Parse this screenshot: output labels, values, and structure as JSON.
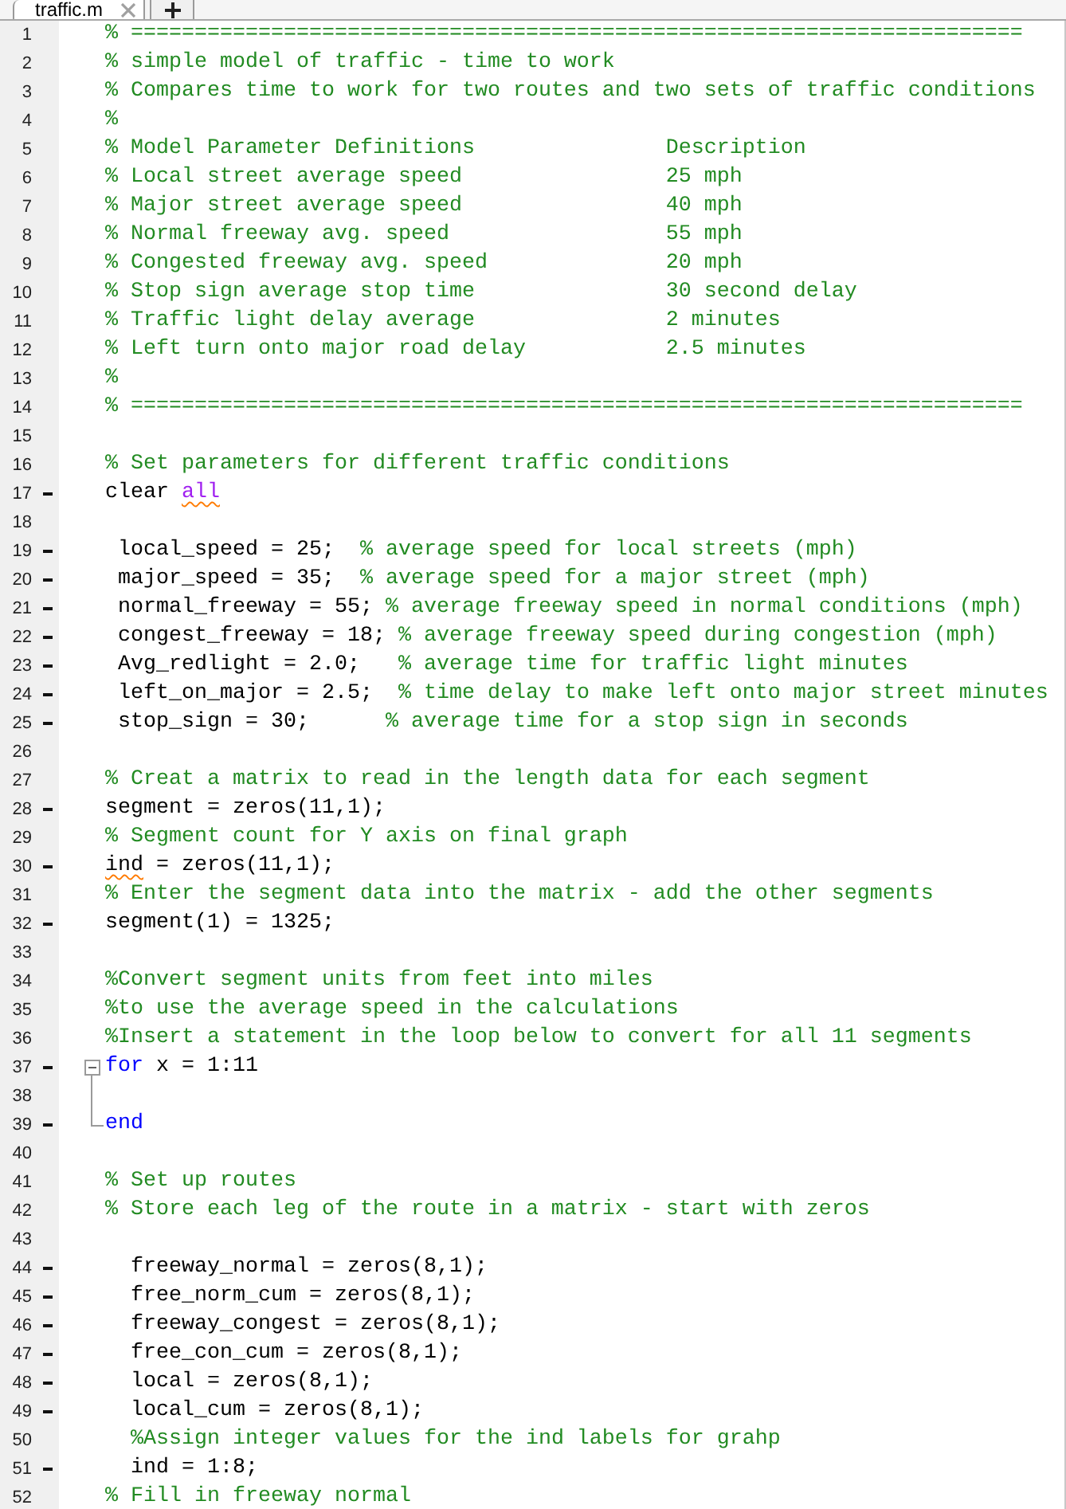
{
  "tabs": [
    {
      "label": "traffic.m",
      "selected": true
    }
  ],
  "lines": [
    {
      "number": "1",
      "executable": false,
      "segments": [
        {
          "kind": "comment",
          "text": "% ======================================================================",
          "warning": false
        }
      ]
    },
    {
      "number": "2",
      "executable": false,
      "segments": [
        {
          "kind": "comment",
          "text": "% simple model of traffic - time to work",
          "warning": false
        }
      ]
    },
    {
      "number": "3",
      "executable": false,
      "segments": [
        {
          "kind": "comment",
          "text": "% Compares time to work for two routes and two sets of traffic conditions",
          "warning": false
        }
      ]
    },
    {
      "number": "4",
      "executable": false,
      "segments": [
        {
          "kind": "comment",
          "text": "%",
          "warning": false
        }
      ]
    },
    {
      "number": "5",
      "executable": false,
      "segments": [
        {
          "kind": "comment",
          "text": "% Model Parameter Definitions               Description",
          "warning": false
        }
      ]
    },
    {
      "number": "6",
      "executable": false,
      "segments": [
        {
          "kind": "comment",
          "text": "% Local street average speed                25 mph",
          "warning": false
        }
      ]
    },
    {
      "number": "7",
      "executable": false,
      "segments": [
        {
          "kind": "comment",
          "text": "% Major street average speed                40 mph",
          "warning": false
        }
      ]
    },
    {
      "number": "8",
      "executable": false,
      "segments": [
        {
          "kind": "comment",
          "text": "% Normal freeway avg. speed                 55 mph",
          "warning": false
        }
      ]
    },
    {
      "number": "9",
      "executable": false,
      "segments": [
        {
          "kind": "comment",
          "text": "% Congested freeway avg. speed              20 mph",
          "warning": false
        }
      ]
    },
    {
      "number": "10",
      "executable": false,
      "segments": [
        {
          "kind": "comment",
          "text": "% Stop sign average stop time               30 second delay",
          "warning": false
        }
      ]
    },
    {
      "number": "11",
      "executable": false,
      "segments": [
        {
          "kind": "comment",
          "text": "% Traffic light delay average               2 minutes",
          "warning": false
        }
      ]
    },
    {
      "number": "12",
      "executable": false,
      "segments": [
        {
          "kind": "comment",
          "text": "% Left turn onto major road delay           2.5 minutes",
          "warning": false
        }
      ]
    },
    {
      "number": "13",
      "executable": false,
      "segments": [
        {
          "kind": "comment",
          "text": "%",
          "warning": false
        }
      ]
    },
    {
      "number": "14",
      "executable": false,
      "segments": [
        {
          "kind": "comment",
          "text": "% ======================================================================",
          "warning": false
        }
      ]
    },
    {
      "number": "15",
      "executable": false
    },
    {
      "number": "16",
      "executable": false,
      "segments": [
        {
          "kind": "comment",
          "text": "% Set parameters for different traffic conditions",
          "warning": false
        }
      ]
    },
    {
      "number": "17",
      "executable": true,
      "segments": [
        {
          "kind": "code",
          "text": "clear ",
          "warning": false
        },
        {
          "kind": "string",
          "text": "all",
          "warning": true
        }
      ]
    },
    {
      "number": "18",
      "executable": false
    },
    {
      "number": "19",
      "executable": true,
      "segments": [
        {
          "kind": "code",
          "text": " local_speed = 25;  ",
          "warning": false
        },
        {
          "kind": "comment",
          "text": "% average speed for local streets (mph)",
          "warning": false
        }
      ]
    },
    {
      "number": "20",
      "executable": true,
      "segments": [
        {
          "kind": "code",
          "text": " major_speed = 35;  ",
          "warning": false
        },
        {
          "kind": "comment",
          "text": "% average speed for a major street (mph)",
          "warning": false
        }
      ]
    },
    {
      "number": "21",
      "executable": true,
      "segments": [
        {
          "kind": "code",
          "text": " normal_freeway = 55; ",
          "warning": false
        },
        {
          "kind": "comment",
          "text": "% average freeway speed in normal conditions (mph)",
          "warning": false
        }
      ]
    },
    {
      "number": "22",
      "executable": true,
      "segments": [
        {
          "kind": "code",
          "text": " congest_freeway = 18; ",
          "warning": false
        },
        {
          "kind": "comment",
          "text": "% average freeway speed during congestion (mph)",
          "warning": false
        }
      ]
    },
    {
      "number": "23",
      "executable": true,
      "segments": [
        {
          "kind": "code",
          "text": " Avg_redlight = 2.0;   ",
          "warning": false
        },
        {
          "kind": "comment",
          "text": "% average time for traffic light minutes",
          "warning": false
        }
      ]
    },
    {
      "number": "24",
      "executable": true,
      "segments": [
        {
          "kind": "code",
          "text": " left_on_major = 2.5;  ",
          "warning": false
        },
        {
          "kind": "comment",
          "text": "% time delay to make left onto major street minutes",
          "warning": false
        }
      ]
    },
    {
      "number": "25",
      "executable": true,
      "segments": [
        {
          "kind": "code",
          "text": " stop_sign = 30;      ",
          "warning": false
        },
        {
          "kind": "comment",
          "text": "% average time for a stop sign in seconds",
          "warning": false
        }
      ]
    },
    {
      "number": "26",
      "executable": false
    },
    {
      "number": "27",
      "executable": false,
      "segments": [
        {
          "kind": "comment",
          "text": "% Creat a matrix to read in the length data for each segment",
          "warning": false
        }
      ]
    },
    {
      "number": "28",
      "executable": true,
      "segments": [
        {
          "kind": "code",
          "text": "segment = zeros(11,1);",
          "warning": false
        }
      ]
    },
    {
      "number": "29",
      "executable": false,
      "segments": [
        {
          "kind": "comment",
          "text": "% Segment count for Y axis on final graph",
          "warning": false
        }
      ]
    },
    {
      "number": "30",
      "executable": true,
      "segments": [
        {
          "kind": "code",
          "text": "ind",
          "warning": true
        },
        {
          "kind": "code",
          "text": " = zeros(11,1);",
          "warning": false
        }
      ]
    },
    {
      "number": "31",
      "executable": false,
      "segments": [
        {
          "kind": "comment",
          "text": "% Enter the segment data into the matrix - add the other segments",
          "warning": false
        }
      ]
    },
    {
      "number": "32",
      "executable": true,
      "segments": [
        {
          "kind": "code",
          "text": "segment(1) = 1325;",
          "warning": false
        }
      ]
    },
    {
      "number": "33",
      "executable": false
    },
    {
      "number": "34",
      "executable": false,
      "segments": [
        {
          "kind": "comment",
          "text": "%Convert segment units from feet into miles",
          "warning": false
        }
      ]
    },
    {
      "number": "35",
      "executable": false,
      "segments": [
        {
          "kind": "comment",
          "text": "%to use the average speed in the calculations",
          "warning": false
        }
      ]
    },
    {
      "number": "36",
      "executable": false,
      "segments": [
        {
          "kind": "comment",
          "text": "%Insert a statement in the loop below to convert for all 11 segments",
          "warning": false
        }
      ]
    },
    {
      "number": "37",
      "executable": true,
      "expanded": true,
      "segments": [
        {
          "kind": "keyword",
          "text": "for",
          "warning": false
        },
        {
          "kind": "code",
          "text": " x = 1:11",
          "warning": false
        }
      ],
      "children": [
        {
          "number": "38",
          "executable": false
        },
        {
          "number": "39",
          "executable": true,
          "segments": [
            {
              "kind": "keyword",
              "text": "end",
              "warning": false
            }
          ]
        }
      ]
    },
    {
      "number": "40",
      "executable": false
    },
    {
      "number": "41",
      "executable": false,
      "segments": [
        {
          "kind": "comment",
          "text": "% Set up routes",
          "warning": false
        }
      ]
    },
    {
      "number": "42",
      "executable": false,
      "segments": [
        {
          "kind": "comment",
          "text": "% Store each leg of the route in a matrix - start with zeros",
          "warning": false
        }
      ]
    },
    {
      "number": "43",
      "executable": false
    },
    {
      "number": "44",
      "executable": true,
      "segments": [
        {
          "kind": "code",
          "text": "  freeway_normal = zeros(8,1);",
          "warning": false
        }
      ]
    },
    {
      "number": "45",
      "executable": true,
      "segments": [
        {
          "kind": "code",
          "text": "  free_norm_cum = zeros(8,1);",
          "warning": false
        }
      ]
    },
    {
      "number": "46",
      "executable": true,
      "segments": [
        {
          "kind": "code",
          "text": "  freeway_congest = zeros(8,1);",
          "warning": false
        }
      ]
    },
    {
      "number": "47",
      "executable": true,
      "segments": [
        {
          "kind": "code",
          "text": "  free_con_cum = zeros(8,1);",
          "warning": false
        }
      ]
    },
    {
      "number": "48",
      "executable": true,
      "segments": [
        {
          "kind": "code",
          "text": "  local = zeros(8,1);",
          "warning": false
        }
      ]
    },
    {
      "number": "49",
      "executable": true,
      "segments": [
        {
          "kind": "code",
          "text": "  local_cum = zeros(8,1);",
          "warning": false
        }
      ]
    },
    {
      "number": "50",
      "executable": false,
      "segments": [
        {
          "kind": "comment",
          "text": "  %Assign integer values for the ind labels for grahp",
          "warning": false
        }
      ]
    },
    {
      "number": "51",
      "executable": true,
      "segments": [
        {
          "kind": "code",
          "text": "  ind = 1:8;",
          "warning": false
        }
      ]
    },
    {
      "number": "52",
      "executable": false,
      "segments": [
        {
          "kind": "comment",
          "text": "% Fill in freeway normal",
          "warning": false
        }
      ]
    }
  ]
}
